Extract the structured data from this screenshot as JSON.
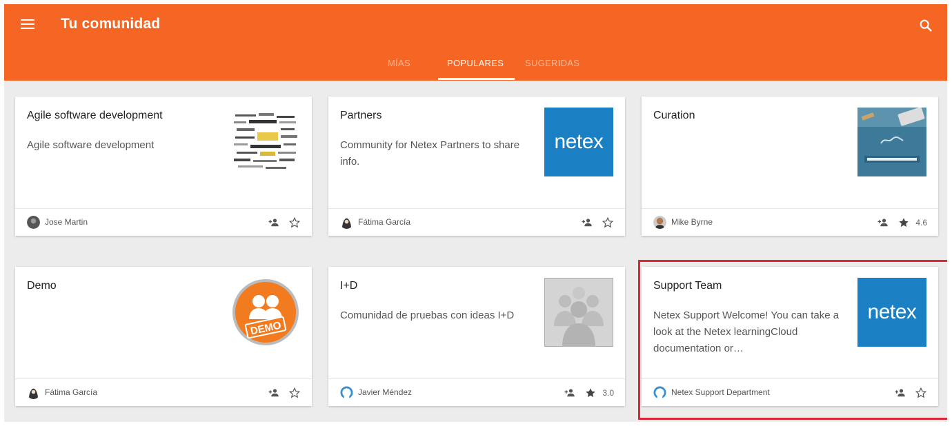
{
  "appbar": {
    "title": "Tu comunidad",
    "background_color": "#f56523",
    "menu_icon": "menu-icon",
    "search_icon": "search-icon"
  },
  "tabs": [
    {
      "label": "MÍAS",
      "selected": false
    },
    {
      "label": "POPULARES",
      "selected": true
    },
    {
      "label": "SUGERIDAS",
      "selected": false
    }
  ],
  "cards": [
    {
      "title": "Agile software development",
      "description": "Agile software development",
      "thumbnail": "agile-word-cloud-image",
      "author": "Jose Martin",
      "avatar": "user-avatar",
      "starred": false,
      "rating": ""
    },
    {
      "title": "Partners",
      "description": "Community for Netex Partners to share info.",
      "thumbnail": "netex-logo",
      "thumbnail_text": "netex",
      "author": "Fátima García",
      "avatar": "user-avatar",
      "starred": false,
      "rating": ""
    },
    {
      "title": "Curation",
      "description": "",
      "thumbnail": "art-content-curation-image",
      "author": "Mike Byrne",
      "avatar": "user-avatar",
      "starred": true,
      "rating": "4.6"
    },
    {
      "title": "Demo",
      "description": "",
      "thumbnail": "demo-badge",
      "thumbnail_text": "DEMO",
      "author": "Fátima García",
      "avatar": "user-avatar",
      "starred": false,
      "rating": ""
    },
    {
      "title": "I+D",
      "description": "Comunidad de pruebas con ideas I+D",
      "thumbnail": "group-placeholder-image",
      "author": "Javier Méndez",
      "avatar": "user-avatar",
      "starred": true,
      "rating": "3.0"
    },
    {
      "title": "Support Team",
      "description": "Netex Support Welcome! You can take a look at the Netex learningCloud documentation or…",
      "thumbnail": "netex-logo",
      "thumbnail_text": "netex",
      "author": "Netex Support Department",
      "avatar": "user-avatar",
      "starred": false,
      "rating": "",
      "highlighted": true
    }
  ],
  "colors": {
    "accent": "#f56523",
    "highlight_border": "#d92a33",
    "netex_blue": "#1b7fc3"
  }
}
